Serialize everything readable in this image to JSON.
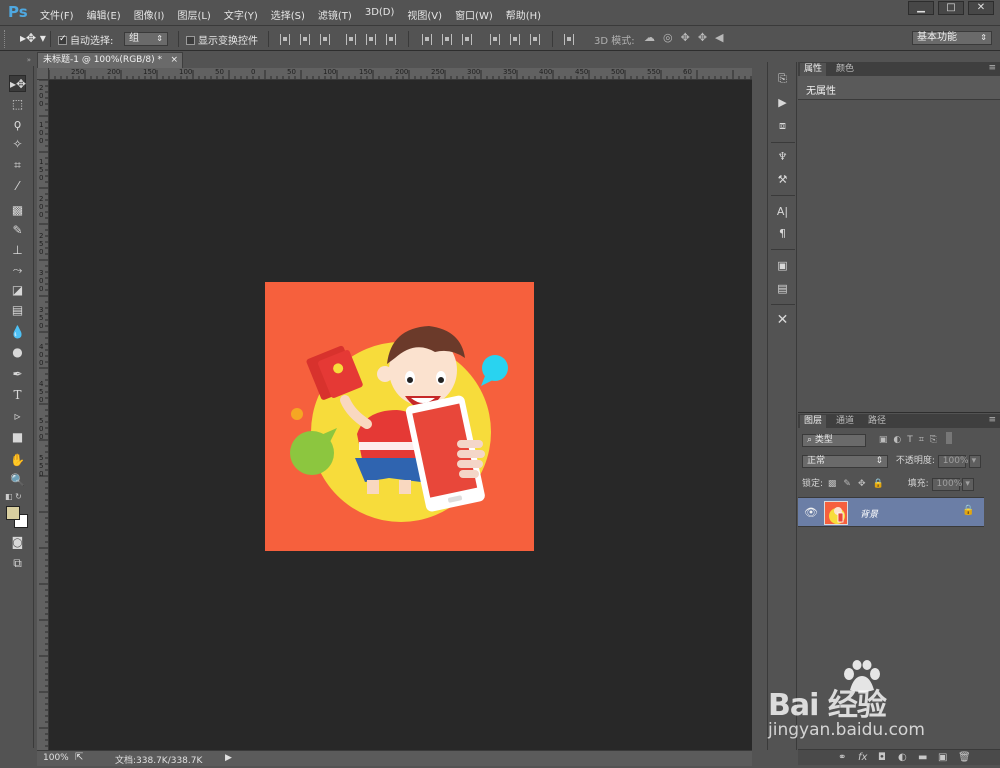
{
  "app": {
    "logo": "Ps"
  },
  "menu": [
    "文件(F)",
    "编辑(E)",
    "图像(I)",
    "图层(L)",
    "文字(Y)",
    "选择(S)",
    "滤镜(T)",
    "3D(D)",
    "视图(V)",
    "窗口(W)",
    "帮助(H)"
  ],
  "window_controls": {
    "minimize": "▁",
    "maximize": "□",
    "close": "✕"
  },
  "options": {
    "auto_select_label": "自动选择:",
    "auto_select_checked": true,
    "auto_select_target": "组",
    "show_transform_label": "显示变换控件",
    "mode_3d_label": "3D 模式:",
    "workspace": "基本功能"
  },
  "document": {
    "tab_title": "未标题-1 @ 100%(RGB/8) *",
    "ruler_h_labels": [
      "250",
      "200",
      "150",
      "100",
      "50",
      "0",
      "50",
      "100",
      "150",
      "200",
      "250",
      "300",
      "350",
      "400",
      "450",
      "500",
      "550",
      "60"
    ],
    "ruler_v_labels": [
      "2",
      "0",
      "0",
      "1",
      "0",
      "0",
      "1",
      "5",
      "0",
      "2",
      "0",
      "0",
      "2",
      "5",
      "0",
      "3",
      "0",
      "0",
      "3",
      "5",
      "0",
      "4",
      "0",
      "0",
      "4",
      "5",
      "0",
      "5",
      "0",
      "0",
      "5",
      "5",
      "0"
    ]
  },
  "status": {
    "zoom": "100%",
    "doc_size": "文档:338.7K/338.7K"
  },
  "properties": {
    "tabs": [
      "属性",
      "颜色"
    ],
    "active_tab": "属性",
    "content": "无属性"
  },
  "layers": {
    "tabs": [
      "图层",
      "通道",
      "路径"
    ],
    "kind_filter": "类型",
    "blend_mode": "正常",
    "opacity_label": "不透明度:",
    "opacity_value": "100%",
    "lock_label": "锁定:",
    "fill_label": "填充:",
    "fill_value": "100%",
    "items": [
      {
        "name": "背景",
        "visible": true,
        "locked": true
      }
    ]
  },
  "watermark": {
    "main": "Bai 经验",
    "sub": "jingyan.baidu.com"
  },
  "colors": {
    "artwork_bg": "#f6603d",
    "yellow_circle": "#f7dc3b",
    "phone_red": "#e8473a",
    "layer_selected": "#6b7ea6",
    "canvas_bg": "#282828"
  }
}
